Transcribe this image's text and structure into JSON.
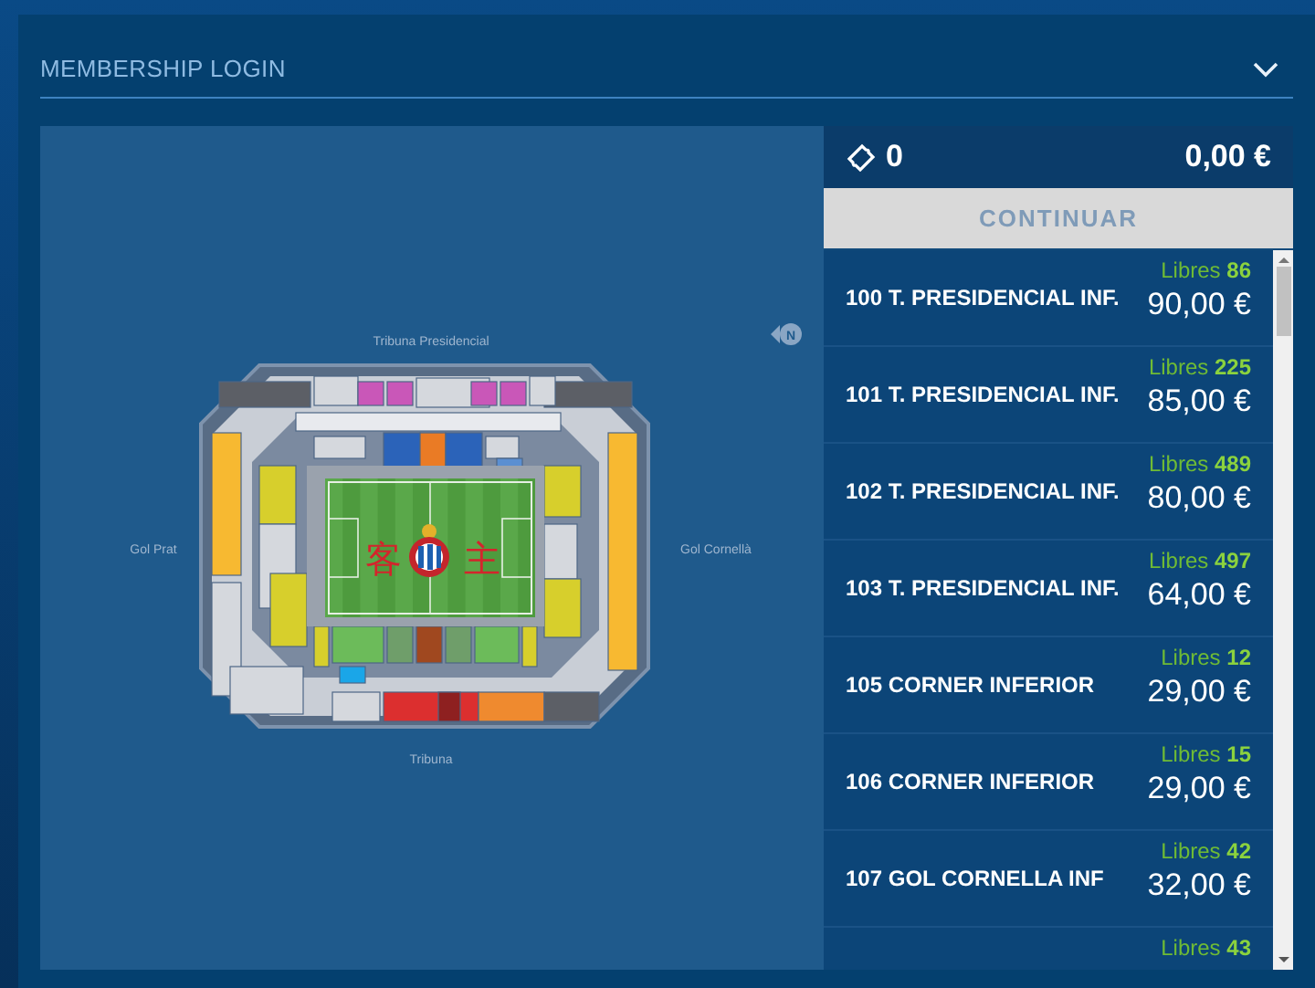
{
  "header": {
    "title": "MEMBERSHIP LOGIN",
    "expanded": false
  },
  "map": {
    "labels": {
      "top": "Tribuna Presidencial",
      "left": "Gol Prat",
      "right": "Gol Cornellà",
      "bottom": "Tribuna"
    },
    "away_mark": "客",
    "home_mark": "主",
    "compass": "N"
  },
  "summary": {
    "tickets": "0",
    "total": "0,00 €"
  },
  "continue_button": {
    "label": "CONTINUAR",
    "disabled": true
  },
  "sectors": [
    {
      "name": "100 T. PRESIDENCIAL INF.",
      "libres_label": "Libres",
      "free": "86",
      "price": "90,00 €"
    },
    {
      "name": "101 T. PRESIDENCIAL INF.",
      "libres_label": "Libres",
      "free": "225",
      "price": "85,00 €"
    },
    {
      "name": "102 T. PRESIDENCIAL INF.",
      "libres_label": "Libres",
      "free": "489",
      "price": "80,00 €"
    },
    {
      "name": "103 T. PRESIDENCIAL INF.",
      "libres_label": "Libres",
      "free": "497",
      "price": "64,00 €"
    },
    {
      "name": "105 CORNER INFERIOR",
      "libres_label": "Libres",
      "free": "12",
      "price": "29,00 €"
    },
    {
      "name": "106 CORNER INFERIOR",
      "libres_label": "Libres",
      "free": "15",
      "price": "29,00 €"
    },
    {
      "name": "107 GOL CORNELLA INF",
      "libres_label": "Libres",
      "free": "42",
      "price": "32,00 €"
    },
    {
      "libres_label": "Libres",
      "free": "43"
    }
  ]
}
